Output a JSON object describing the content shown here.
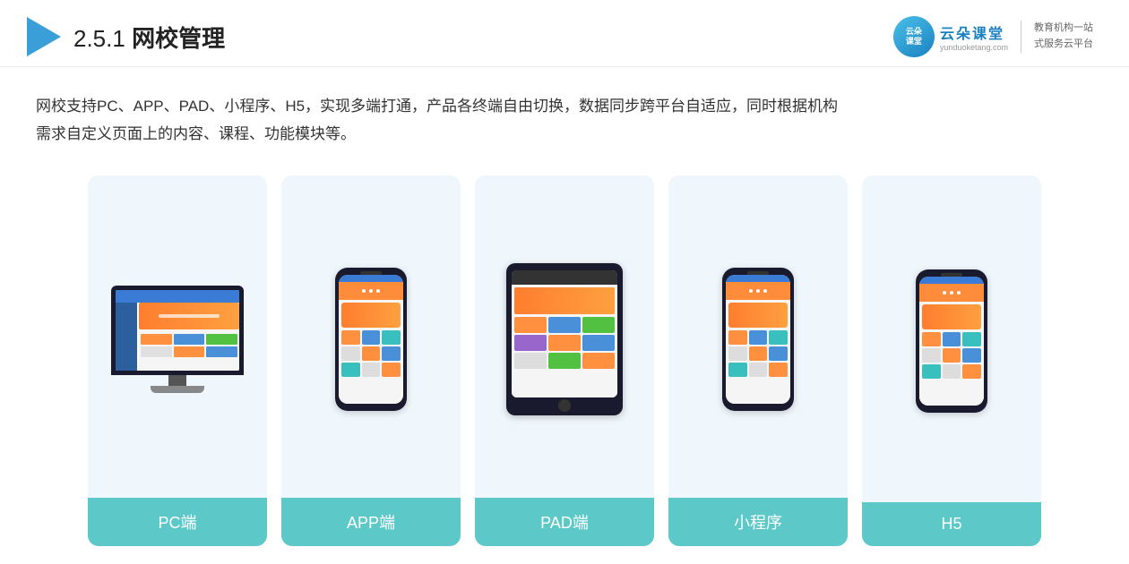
{
  "header": {
    "section_number": "2.5.1",
    "title_normal": "网校",
    "title_bold": "管理",
    "full_title": "2.5.1 网校管理"
  },
  "brand": {
    "name": "云朵课堂",
    "url": "yunduoketang.com",
    "slogan_line1": "教育机构一站",
    "slogan_line2": "式服务云平台",
    "icon_text": "云朵\n课堂"
  },
  "description": {
    "text": "网校支持PC、APP、PAD、小程序、H5，实现多端打通，产品各终端自由切换，数据同步跨平台自适应，同时根据机构需求自定义页面上的内容、课程、功能模块等。"
  },
  "cards": [
    {
      "id": "pc",
      "label": "PC端",
      "device_type": "monitor"
    },
    {
      "id": "app",
      "label": "APP端",
      "device_type": "phone"
    },
    {
      "id": "pad",
      "label": "PAD端",
      "device_type": "pad"
    },
    {
      "id": "miniapp",
      "label": "小程序",
      "device_type": "phone"
    },
    {
      "id": "h5",
      "label": "H5",
      "device_type": "phone"
    }
  ]
}
